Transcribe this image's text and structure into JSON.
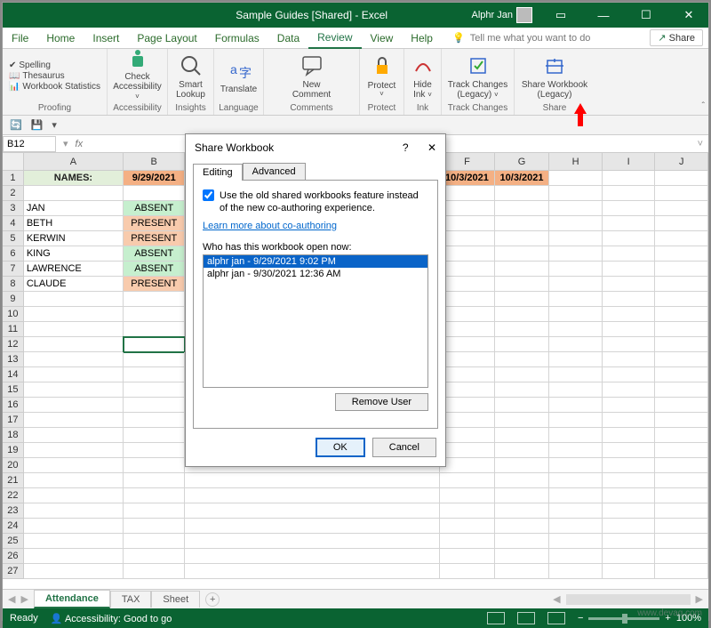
{
  "titlebar": {
    "title": "Sample Guides [Shared] - Excel",
    "user": "Alphr Jan"
  },
  "menu": {
    "file": "File",
    "home": "Home",
    "insert": "Insert",
    "pagelayout": "Page Layout",
    "formulas": "Formulas",
    "data": "Data",
    "review": "Review",
    "view": "View",
    "help": "Help",
    "tellme": "Tell me what you want to do",
    "share": "Share"
  },
  "ribbon": {
    "proofing": {
      "spelling": "Spelling",
      "thesaurus": "Thesaurus",
      "stats": "Workbook Statistics",
      "label": "Proofing"
    },
    "acc": {
      "check": "Check",
      "sub": "Accessibility",
      "label": "Accessibility",
      "drop": "˅"
    },
    "insights": {
      "smart": "Smart",
      "lookup": "Lookup",
      "label": "Insights"
    },
    "lang": {
      "translate": "Translate",
      "label": "Language"
    },
    "comments": {
      "new": "New",
      "comment": "Comment",
      "label": "Comments"
    },
    "protect": {
      "protect": "Protect",
      "label": "Protect",
      "drop": "˅"
    },
    "ink": {
      "hide": "Hide",
      "sub": "Ink",
      "label": "Ink",
      "drop": "˅"
    },
    "track": {
      "track": "Track Changes",
      "legacy": "(Legacy)",
      "label": "Track Changes",
      "drop": "˅"
    },
    "shareg": {
      "share": "Share Workbook",
      "legacy": "(Legacy)",
      "label": "Share"
    }
  },
  "namebox": {
    "cell": "B12"
  },
  "cols": {
    "A": "A",
    "B": "B",
    "F": "F",
    "G": "G",
    "H": "H",
    "I": "I",
    "J": "J"
  },
  "sheet": {
    "header": {
      "names": "NAMES:",
      "b": "9/29/2021",
      "f": "10/3/2021",
      "g": "10/3/2021"
    },
    "rows": [
      {
        "n": "",
        "b": ""
      },
      {
        "n": "JAN",
        "b": "ABSENT"
      },
      {
        "n": "BETH",
        "b": "PRESENT"
      },
      {
        "n": "KERWIN",
        "b": "PRESENT"
      },
      {
        "n": "KING",
        "b": "ABSENT"
      },
      {
        "n": "LAWRENCE",
        "b": "ABSENT"
      },
      {
        "n": "CLAUDE",
        "b": "PRESENT"
      }
    ]
  },
  "tabs": {
    "attendance": "Attendance",
    "tax": "TAX",
    "sheet": "Sheet"
  },
  "status": {
    "ready": "Ready",
    "acc": "Accessibility: Good to go",
    "zoom": "100%"
  },
  "dialog": {
    "title": "Share Workbook",
    "tab_editing": "Editing",
    "tab_advanced": "Advanced",
    "checkbox": "Use the old shared workbooks feature instead of the new co-authoring experience.",
    "learn": "Learn more about co-authoring",
    "who": "Who has this workbook open now:",
    "users": [
      "alphr jan - 9/29/2021 9:02 PM",
      "alphr jan - 9/30/2021 12:36 AM"
    ],
    "remove": "Remove User",
    "ok": "OK",
    "cancel": "Cancel"
  },
  "watermark": "www.devaq.com"
}
